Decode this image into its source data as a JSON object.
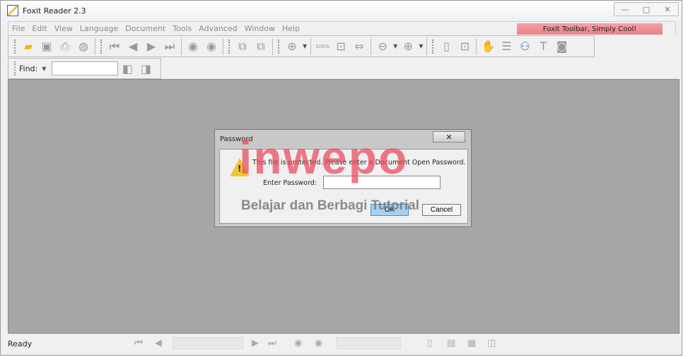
{
  "window": {
    "title": "Foxit Reader 2.3",
    "minimize": "—",
    "maximize": "□",
    "close": "✕"
  },
  "menu": [
    "File",
    "Edit",
    "View",
    "Language",
    "Document",
    "Tools",
    "Advanced",
    "Window",
    "Help"
  ],
  "promo": "Foxit Toolbar, Simply Cool!",
  "toolbar": {
    "icons": [
      "open-folder-icon",
      "save-icon",
      "print-icon",
      "web-icon",
      "first-page-icon",
      "prev-page-icon",
      "next-page-icon",
      "last-page-icon",
      "back-icon",
      "forward-icon",
      "rotate-cw-icon",
      "rotate-ccw-icon",
      "zoom-in-icon",
      "actual-size-icon",
      "fit-page-icon",
      "fit-width-icon",
      "zoom-out-icon",
      "zoom-plus-icon",
      "bookmark-icon",
      "fullscreen-icon",
      "hand-icon",
      "select-icon",
      "find-icon",
      "text-tool-icon",
      "snapshot-icon"
    ],
    "actual_size_label": "100%"
  },
  "find": {
    "label": "Find:",
    "value": ""
  },
  "dialog": {
    "title": "Password",
    "close": "✕",
    "message": "This file is protected. Please enter a Document Open Password.",
    "field_label": "Enter Password:",
    "password": "",
    "ok": "OK",
    "cancel": "Cancel"
  },
  "watermark": {
    "brand": "inwepo",
    "tagline": "Belajar dan Berbagi Tutorial"
  },
  "status": {
    "text": "Ready"
  }
}
